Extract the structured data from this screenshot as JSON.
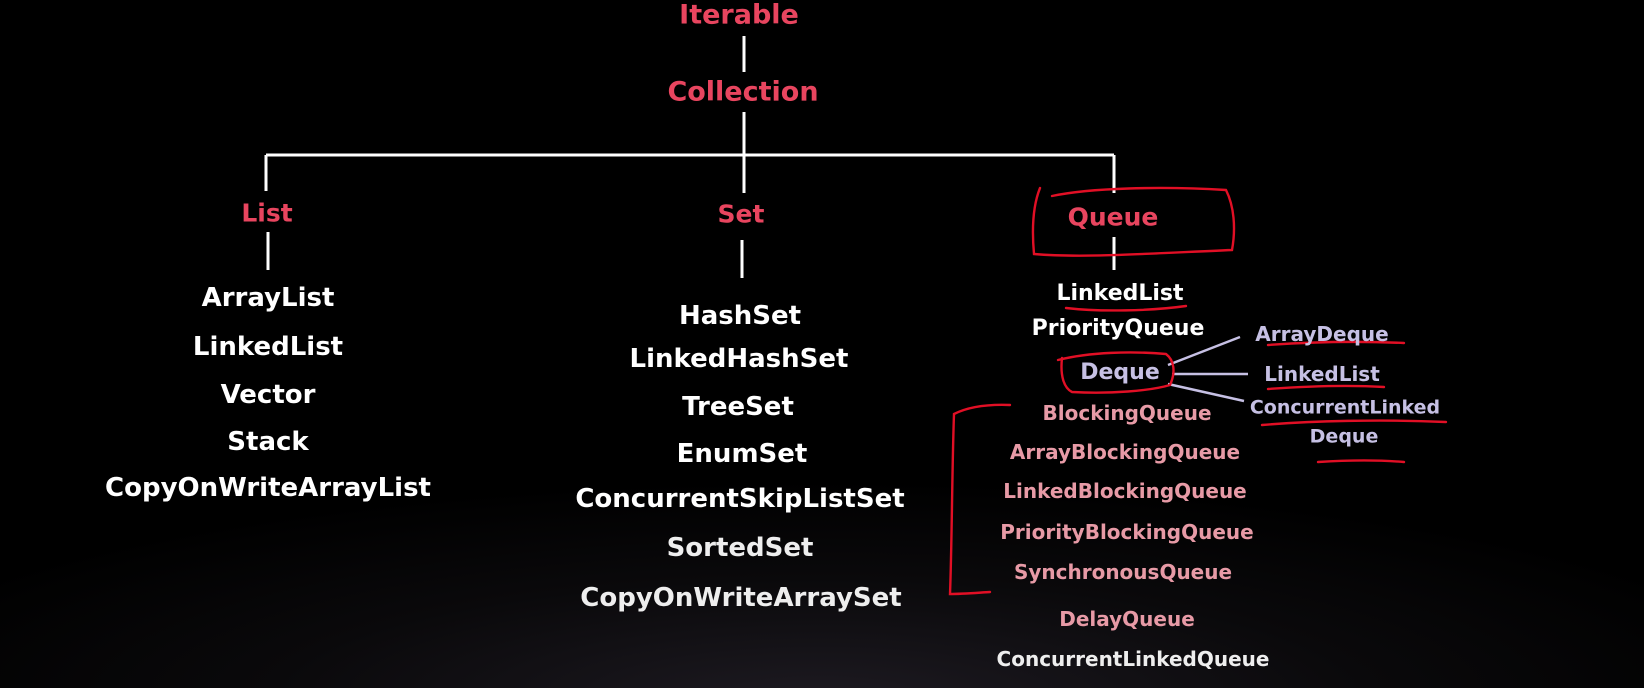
{
  "root": "Iterable",
  "collection": "Collection",
  "list": {
    "title": "List",
    "items": [
      "ArrayList",
      "LinkedList",
      "Vector",
      "Stack",
      "CopyOnWriteArrayList"
    ]
  },
  "set": {
    "title": "Set",
    "items": [
      "HashSet",
      "LinkedHashSet",
      "TreeSet",
      "EnumSet",
      "ConcurrentSkipListSet",
      "SortedSet",
      "CopyOnWriteArraySet"
    ]
  },
  "queue": {
    "title": "Queue",
    "items": [
      "LinkedList",
      "PriorityQueue"
    ],
    "deque": {
      "title": "Deque",
      "items": [
        "ArrayDeque",
        "LinkedList",
        "ConcurrentLinked",
        "Deque"
      ]
    },
    "blocking": [
      "BlockingQueue",
      "ArrayBlockingQueue",
      "LinkedBlockingQueue",
      "PriorityBlockingQueue",
      "SynchronousQueue"
    ],
    "other": [
      "DelayQueue",
      "ConcurrentLinkedQueue"
    ]
  }
}
